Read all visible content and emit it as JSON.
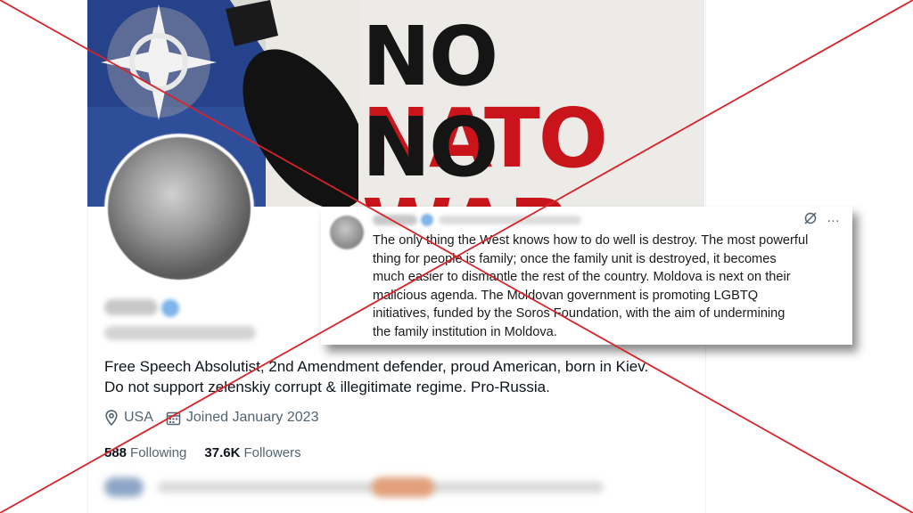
{
  "banner": {
    "line1_black": "NO ",
    "line1_red": "NATO",
    "line2_black": "NO ",
    "line2_red": "WAR"
  },
  "profile": {
    "bio": [
      "Free Speech Absolutist, 2nd Amendment defender, proud American, born in Kiev.",
      "Do not support zelenskiy corrupt & illegitimate regime. Pro-Russia."
    ],
    "location": "USA",
    "joined": "Joined January 2023",
    "following_count": "588",
    "following_label": "Following",
    "followers_count": "37.6K",
    "followers_label": "Followers"
  },
  "tweet": {
    "more_icon": "…",
    "lines": [
      "The only thing the West knows how to do well is destroy. The most powerful",
      "thing for people is family; once the family unit is destroyed, it becomes",
      "much easier to dismantle the rest of the country. Moldova is next on their",
      "malicious agenda. The Moldovan government is promoting LGBTQ",
      "initiatives, funded by the Soros Foundation, with the aim of undermining",
      "the family institution in Moldova."
    ]
  },
  "colors": {
    "cross": "#d9232a",
    "banner_red": "#c8141a",
    "muted_text": "#536471"
  },
  "icons": [
    "location-icon",
    "calendar-icon",
    "grok-icon",
    "more-icon"
  ]
}
